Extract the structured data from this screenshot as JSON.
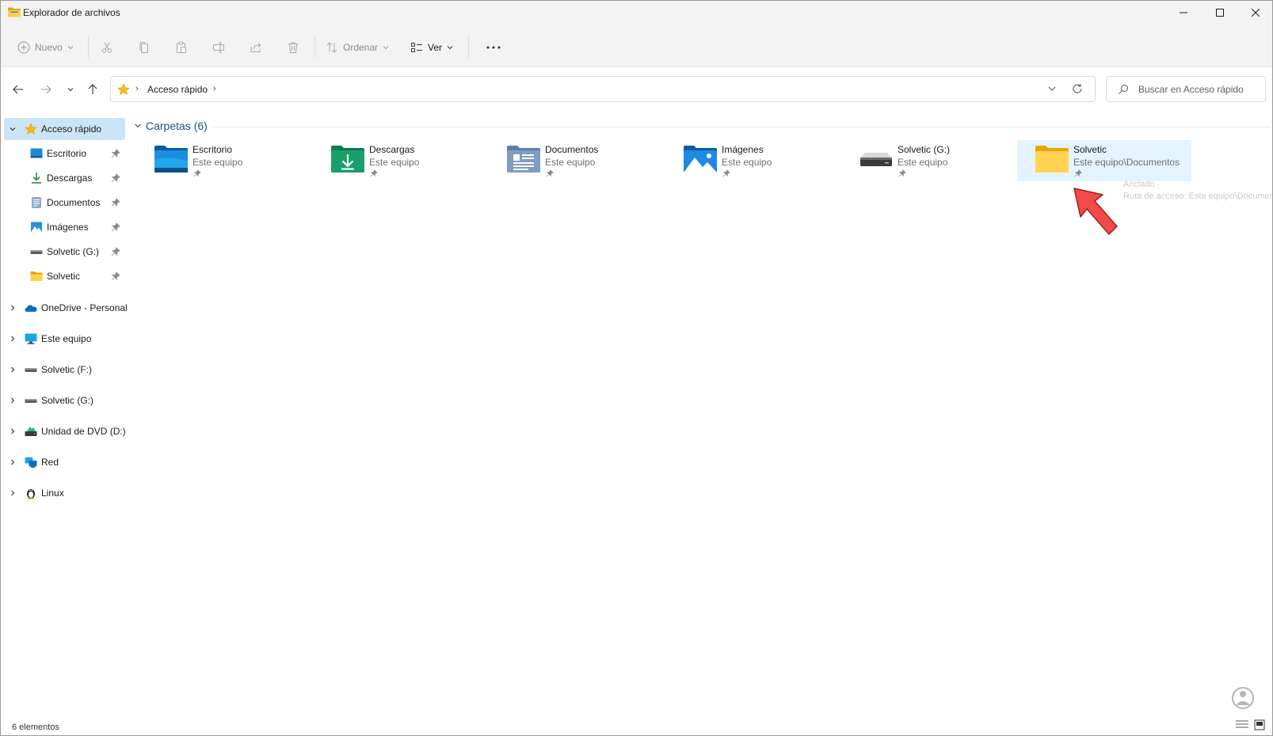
{
  "window": {
    "title": "Explorador de archivos",
    "accent": "#0067c0",
    "selection_color": "#cce4f7",
    "hover_color": "#e5f3ff"
  },
  "toolbar": {
    "new_label": "Nuevo",
    "sort_label": "Ordenar",
    "view_label": "Ver",
    "icons": [
      "new-icon",
      "cut-icon",
      "copy-icon",
      "paste-icon",
      "rename-icon",
      "share-icon",
      "delete-icon",
      "sort-icon",
      "view-icon",
      "more-icon"
    ]
  },
  "address": {
    "crumb": "Acceso rápido",
    "search_placeholder": "Buscar en Acceso rápido"
  },
  "sidebar": {
    "quick_access": {
      "label": "Acceso rápido",
      "items": [
        {
          "label": "Escritorio",
          "icon": "desktop-icon",
          "pinned": true
        },
        {
          "label": "Descargas",
          "icon": "downloads-icon",
          "pinned": true
        },
        {
          "label": "Documentos",
          "icon": "documents-icon",
          "pinned": true
        },
        {
          "label": "Imágenes",
          "icon": "pictures-icon",
          "pinned": true
        },
        {
          "label": "Solvetic (G:)",
          "icon": "drive-icon",
          "pinned": true
        },
        {
          "label": "Solvetic",
          "icon": "folder-icon",
          "pinned": true
        }
      ]
    },
    "roots": [
      {
        "label": "OneDrive - Personal",
        "icon": "onedrive-icon"
      },
      {
        "label": "Este equipo",
        "icon": "pc-icon"
      },
      {
        "label": "Solvetic (F:)",
        "icon": "drive-icon"
      },
      {
        "label": "Solvetic (G:)",
        "icon": "drive-icon"
      },
      {
        "label": "Unidad de DVD (D:)",
        "icon": "dvd-icon"
      },
      {
        "label": "Red",
        "icon": "network-icon"
      },
      {
        "label": "Linux",
        "icon": "linux-icon"
      }
    ]
  },
  "main": {
    "group_label": "Carpetas (6)",
    "tiles": [
      {
        "name": "Escritorio",
        "location": "Este equipo",
        "icon": "desktop-folder-icon"
      },
      {
        "name": "Descargas",
        "location": "Este equipo",
        "icon": "downloads-folder-icon"
      },
      {
        "name": "Documentos",
        "location": "Este equipo",
        "icon": "documents-folder-icon"
      },
      {
        "name": "Imágenes",
        "location": "Este equipo",
        "icon": "pictures-folder-icon"
      },
      {
        "name": "Solvetic (G:)",
        "location": "Este equipo",
        "icon": "drive-icon"
      },
      {
        "name": "Solvetic",
        "location": "Este equipo\\Documentos",
        "icon": "folder-icon"
      }
    ],
    "tooltip": {
      "line1": "Anclado",
      "line2": "Ruta de acceso: Este equipo\\Documentos"
    }
  },
  "status": {
    "count": "6 elementos"
  }
}
